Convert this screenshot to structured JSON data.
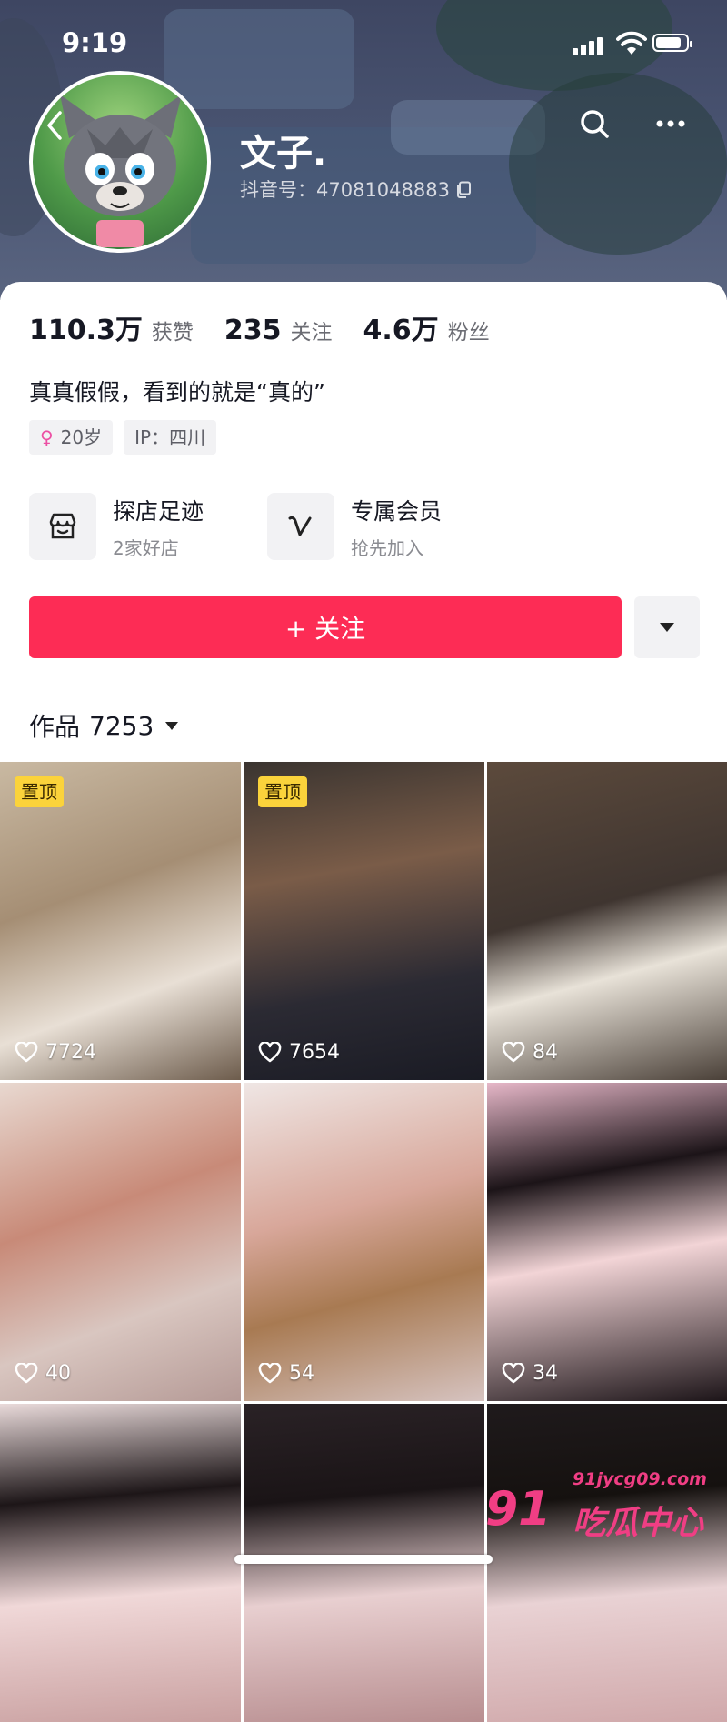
{
  "status_bar": {
    "time": "9:19",
    "battery_level": 0.85
  },
  "profile": {
    "name": "文子.",
    "douyin_id_label": "抖音号：",
    "douyin_id": "47081048883",
    "stats": [
      {
        "num": "110.3万",
        "label": "获赞"
      },
      {
        "num": "235",
        "label": "关注"
      },
      {
        "num": "4.6万",
        "label": "粉丝"
      }
    ],
    "bio": "真真假假，看到的就是“真的”",
    "tags": {
      "age": "20岁",
      "ip": "IP：四川"
    }
  },
  "features": [
    {
      "title": "探店足迹",
      "subtitle": "2家好店",
      "icon": "shop-icon"
    },
    {
      "title": "专属会员",
      "subtitle": "抢先加入",
      "icon": "vip-icon"
    }
  ],
  "follow_label": "+ 关注",
  "works": {
    "label": "作品",
    "count": "7253"
  },
  "videos": [
    {
      "likes": "7724",
      "pinned": true,
      "pin_label": "置顶"
    },
    {
      "likes": "7654",
      "pinned": true,
      "pin_label": "置顶"
    },
    {
      "likes": "84",
      "pinned": false
    },
    {
      "likes": "40",
      "pinned": false
    },
    {
      "likes": "54",
      "pinned": false
    },
    {
      "likes": "34",
      "pinned": false
    },
    {
      "likes": "",
      "pinned": false
    },
    {
      "likes": "",
      "pinned": false
    },
    {
      "likes": "",
      "pinned": false
    }
  ],
  "watermark": {
    "num": "91",
    "url": "91jycg09.com",
    "text": "吃瓜中心"
  },
  "colors": {
    "accent": "#fd2c55",
    "pin": "#fbd33b"
  }
}
